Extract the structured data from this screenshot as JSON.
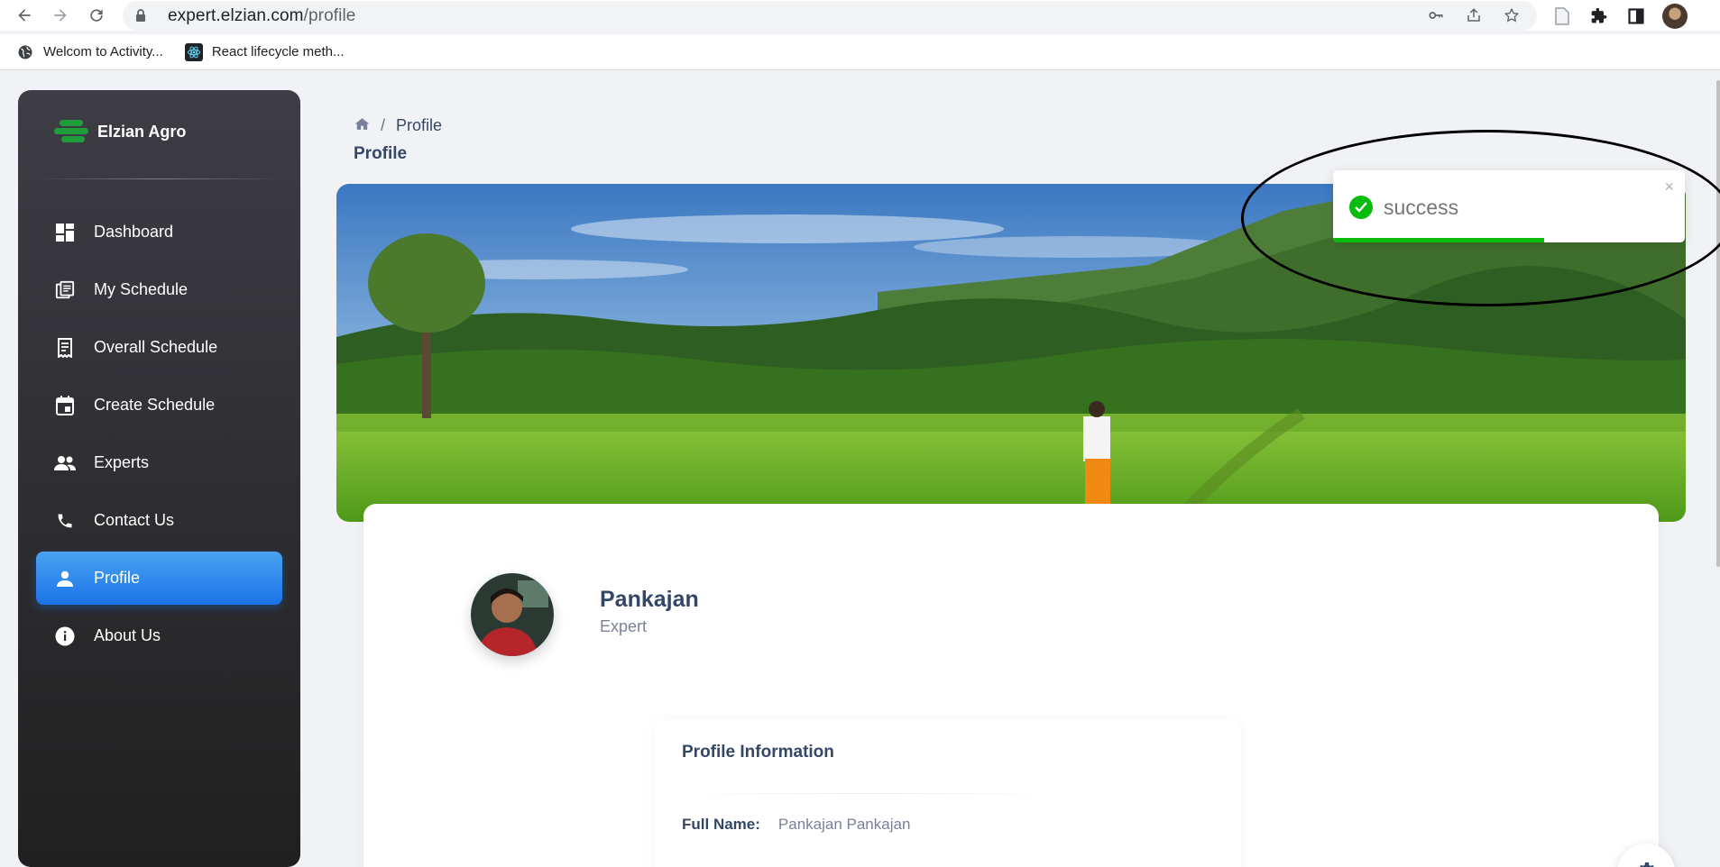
{
  "browser": {
    "url_host": "expert.elzian.com",
    "url_path": "/profile",
    "bookmarks": [
      {
        "label": "Welcom to Activity...",
        "icon": "globe-icon"
      },
      {
        "label": "React lifecycle meth...",
        "icon": "react-icon"
      }
    ]
  },
  "sidebar": {
    "brand": "Elzian Agro",
    "items": [
      {
        "label": "Dashboard",
        "icon": "dashboard-icon"
      },
      {
        "label": "My Schedule",
        "icon": "schedule-icon"
      },
      {
        "label": "Overall Schedule",
        "icon": "receipt-icon"
      },
      {
        "label": "Create Schedule",
        "icon": "calendar-icon"
      },
      {
        "label": "Experts",
        "icon": "people-icon"
      },
      {
        "label": "Contact Us",
        "icon": "phone-icon"
      },
      {
        "label": "Profile",
        "icon": "person-icon",
        "active": true
      },
      {
        "label": "About Us",
        "icon": "info-icon"
      }
    ]
  },
  "breadcrumb": {
    "current": "Profile"
  },
  "page_title": "Profile",
  "profile": {
    "name": "Pankajan",
    "role": "Expert",
    "info_title": "Profile Information",
    "full_name_label": "Full Name:",
    "full_name_value": "Pankajan Pankajan"
  },
  "toast": {
    "message": "success",
    "close": "×",
    "progress": 0.6,
    "color": "#07bc0c"
  },
  "colors": {
    "sidebar_active": "#1a73e8",
    "heading": "#344767",
    "muted": "#7b809a"
  }
}
